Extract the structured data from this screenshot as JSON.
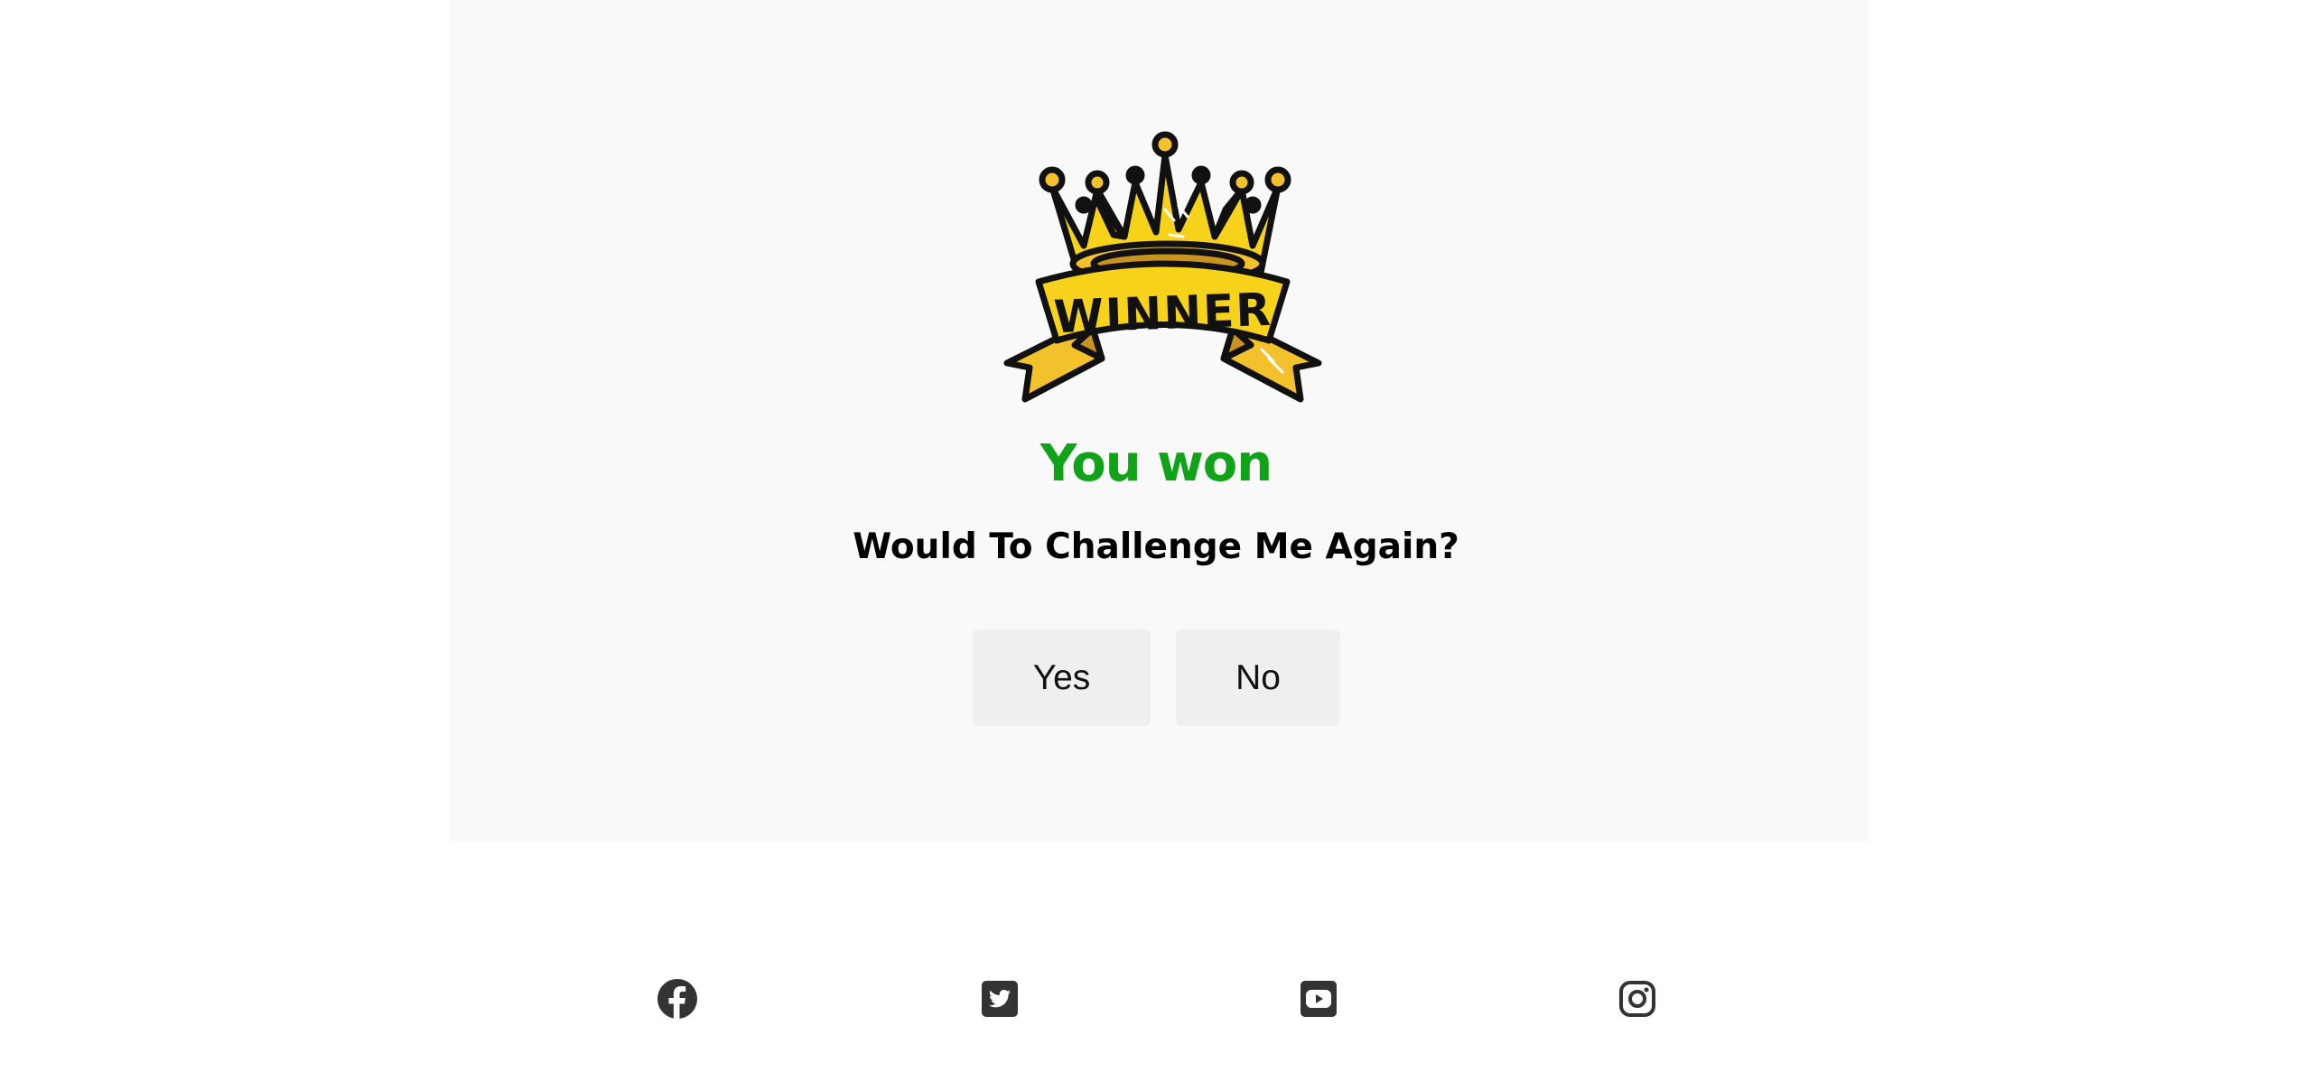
{
  "result": {
    "title": "You won",
    "title_color": "#11a317"
  },
  "prompt": {
    "question": "Would To Challenge Me Again?"
  },
  "buttons": {
    "yes_label": "Yes",
    "no_label": "No"
  },
  "crown_image": {
    "banner_text": "WINNER",
    "icon": "winner-crown"
  },
  "social": [
    {
      "name": "facebook",
      "icon": "facebook-icon"
    },
    {
      "name": "twitter",
      "icon": "twitter-icon"
    },
    {
      "name": "youtube",
      "icon": "youtube-icon"
    },
    {
      "name": "instagram",
      "icon": "instagram-icon"
    }
  ],
  "colors": {
    "card_background": "#f9f9f9",
    "button_background": "#efefef",
    "icon_color": "#333333",
    "crown_gold": "#f7d21a"
  }
}
